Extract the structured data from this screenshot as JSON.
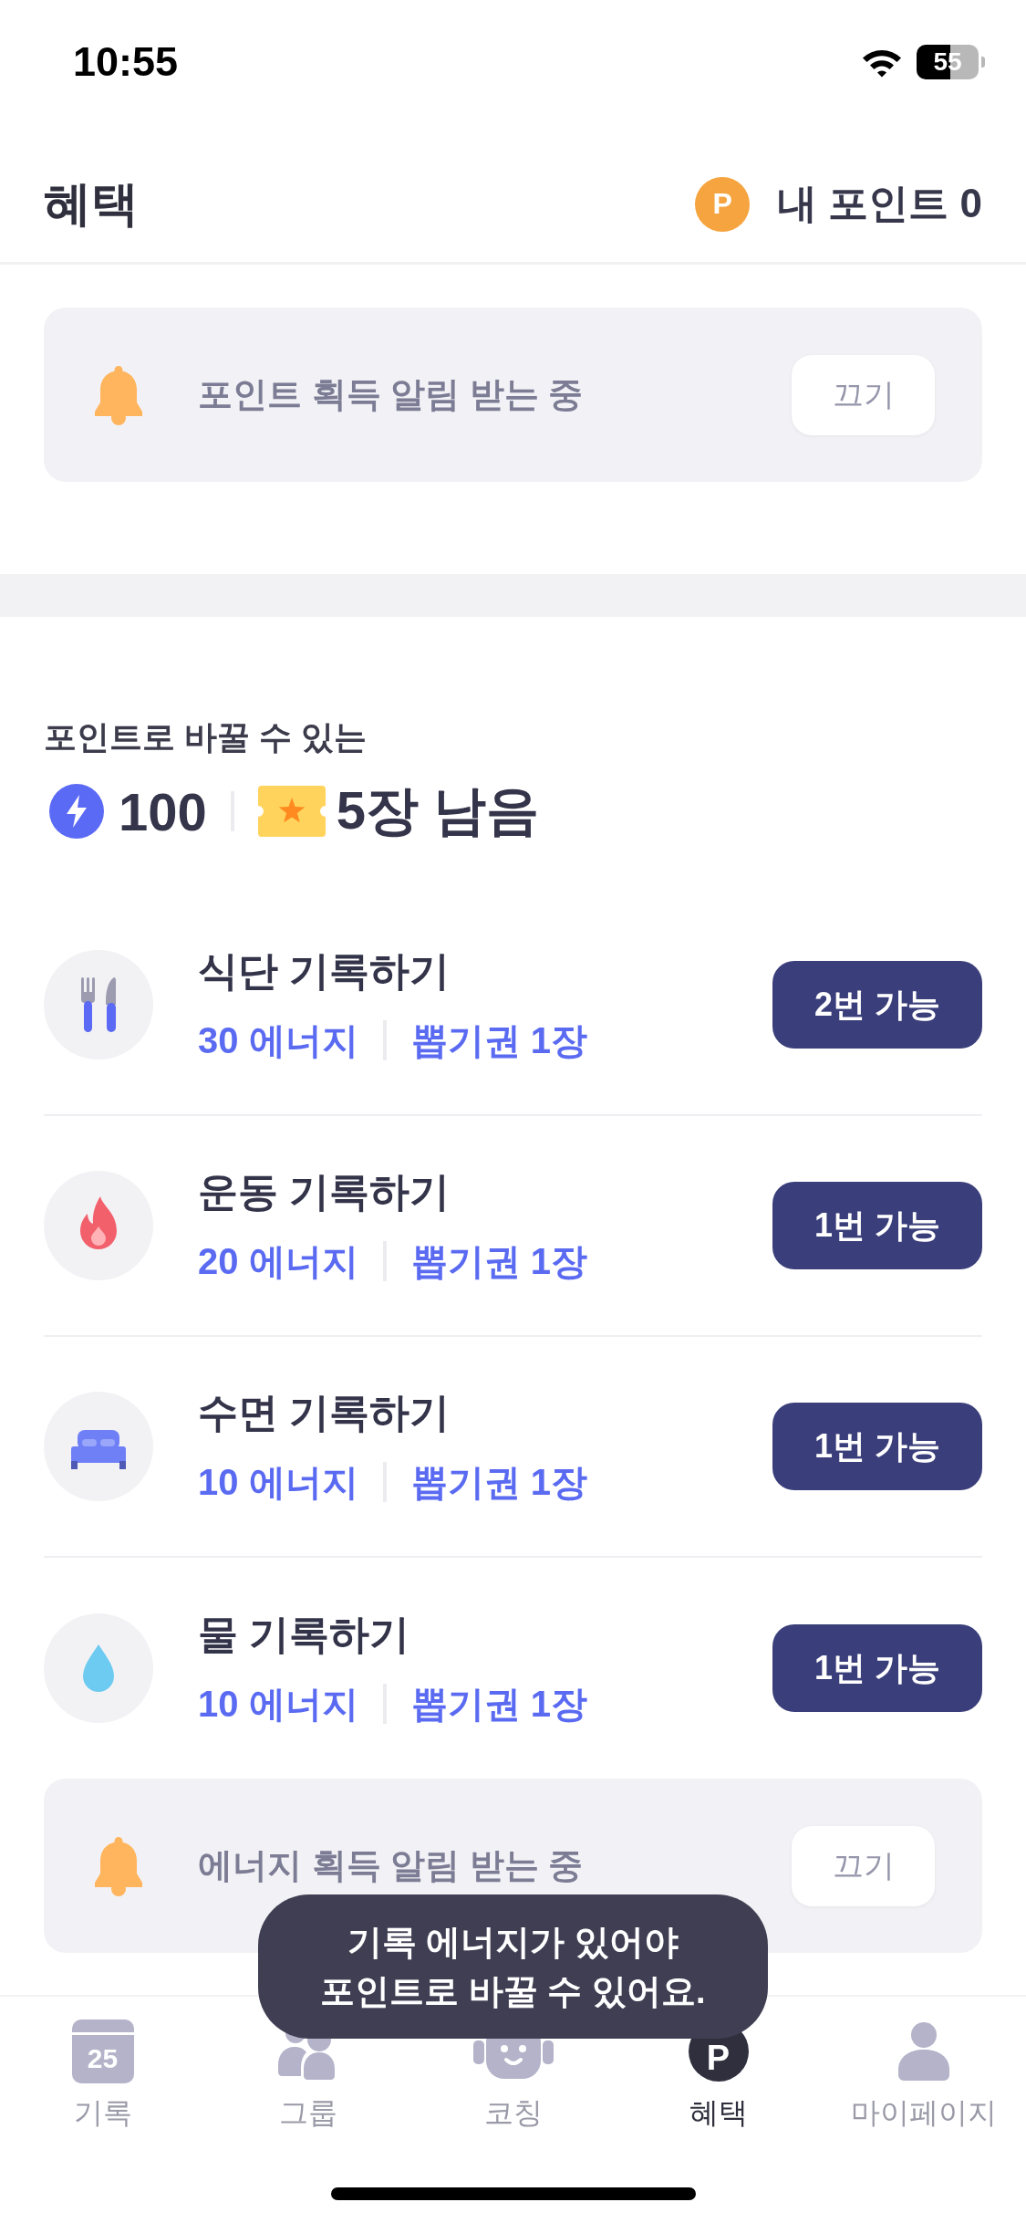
{
  "status_bar": {
    "time": "10:55",
    "battery": "55"
  },
  "header": {
    "title": "혜택",
    "points_badge": "P",
    "points_label": "내 포인트 0"
  },
  "point_alert": {
    "message": "포인트 획득 알림 받는 중",
    "button": "끄기"
  },
  "exchange": {
    "caption": "포인트로 바꿀 수 있는",
    "energy": "100",
    "tickets": "5장 남음"
  },
  "tasks": [
    {
      "kind": "meal",
      "title": "식단 기록하기",
      "energy": "30 에너지",
      "tickets": "뽑기권 1장",
      "button": "2번 가능"
    },
    {
      "kind": "exercise",
      "title": "운동 기록하기",
      "energy": "20 에너지",
      "tickets": "뽑기권 1장",
      "button": "1번 가능"
    },
    {
      "kind": "sleep",
      "title": "수면 기록하기",
      "energy": "10 에너지",
      "tickets": "뽑기권 1장",
      "button": "1번 가능"
    },
    {
      "kind": "water",
      "title": "물 기록하기",
      "energy": "10 에너지",
      "tickets": "뽑기권 1장",
      "button": "1번 가능"
    }
  ],
  "energy_alert": {
    "message": "에너지 획득 알림 받는 중",
    "button": "끄기"
  },
  "toast": {
    "text": "기록 에너지가 있어야\n포인트로 바꿀 수 있어요."
  },
  "tab_bar": [
    {
      "kind": "calendar",
      "label": "기록",
      "icon_text": "25",
      "selected": false
    },
    {
      "kind": "group",
      "label": "그룹",
      "selected": false
    },
    {
      "kind": "coach",
      "label": "코칭",
      "selected": false
    },
    {
      "kind": "benefit",
      "label": "혜택",
      "icon_text": "P",
      "selected": true
    },
    {
      "kind": "profile",
      "label": "마이페이지",
      "selected": false
    }
  ]
}
